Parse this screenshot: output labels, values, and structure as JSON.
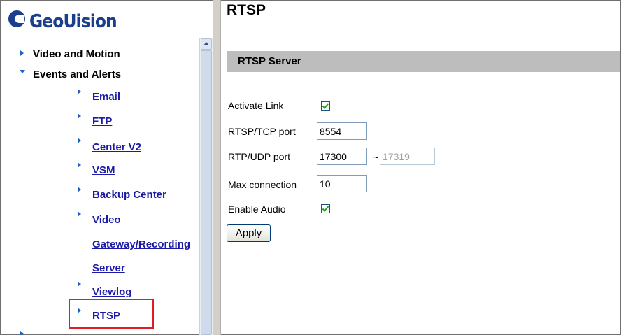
{
  "logo": {
    "text": "GeoUision"
  },
  "nav": {
    "items": [
      {
        "label": "Video and Motion",
        "level": 1,
        "expanded": false
      },
      {
        "label": "Events and Alerts",
        "level": 1,
        "expanded": true
      },
      {
        "label": "Email",
        "level": 2
      },
      {
        "label": "FTP",
        "level": 2
      },
      {
        "label": "Center V2",
        "level": 2
      },
      {
        "label": "VSM",
        "level": 2
      },
      {
        "label": "Backup Center",
        "level": 2
      },
      {
        "label": "Video",
        "level": 2
      },
      {
        "label": "Gateway/Recording",
        "level": 2
      },
      {
        "label": "Server",
        "level": 2
      },
      {
        "label": "Viewlog",
        "level": 2
      },
      {
        "label": "RTSP",
        "level": 2,
        "selected": true
      }
    ]
  },
  "page": {
    "title": "RTSP",
    "section_title": "RTSP Server"
  },
  "form": {
    "activate_link": {
      "label": "Activate Link",
      "checked": true
    },
    "tcp_port": {
      "label": "RTSP/TCP port",
      "value": "8554"
    },
    "udp_port": {
      "label": "RTP/UDP port",
      "value": "17300",
      "separator": "~",
      "end_value": "17319"
    },
    "max_connection": {
      "label": "Max connection",
      "value": "10"
    },
    "enable_audio": {
      "label": "Enable Audio",
      "checked": true
    },
    "apply_label": "Apply"
  },
  "colors": {
    "highlight": "#e31b23",
    "link": "#1a1aa6",
    "brand": "#1b3f8c",
    "section_bar": "#bdbdbd"
  }
}
